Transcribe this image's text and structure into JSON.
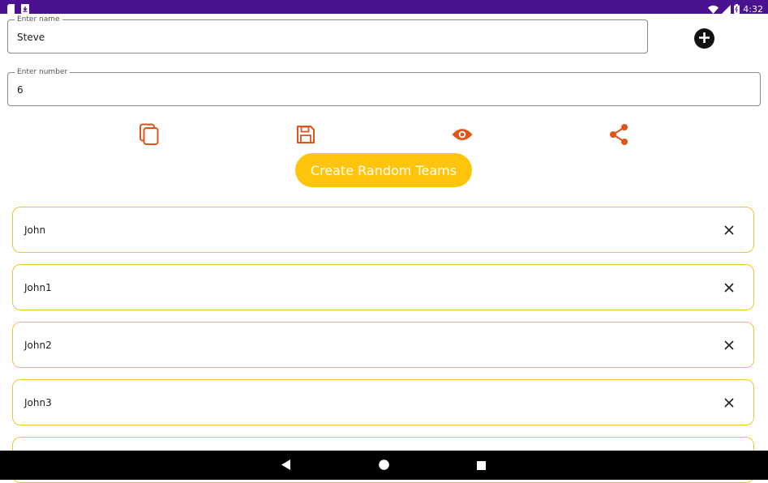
{
  "status_bar": {
    "time": "4:32",
    "left_icons": [
      "sd-card-icon",
      "download-icon"
    ],
    "right_icons": [
      "wifi-icon",
      "signal-icon",
      "battery-icon"
    ]
  },
  "name_field": {
    "label": "Enter name",
    "value": "Steve"
  },
  "number_field": {
    "label": "Enter number",
    "value": "6"
  },
  "add_button": {
    "icon": "plus-circle-icon"
  },
  "toolbar": {
    "icons": [
      "copy-icon",
      "save-icon",
      "eye-icon",
      "share-icon"
    ],
    "accent_color": "#e0541a"
  },
  "create_button": {
    "label": "Create Random Teams",
    "color": "#ffc40c"
  },
  "names": [
    {
      "label": "John"
    },
    {
      "label": "John1"
    },
    {
      "label": "John2"
    },
    {
      "label": "John3"
    }
  ],
  "list_border_color": "#f2c232",
  "nav_bar": {
    "icons": [
      "back-icon",
      "home-icon",
      "recents-icon"
    ]
  }
}
